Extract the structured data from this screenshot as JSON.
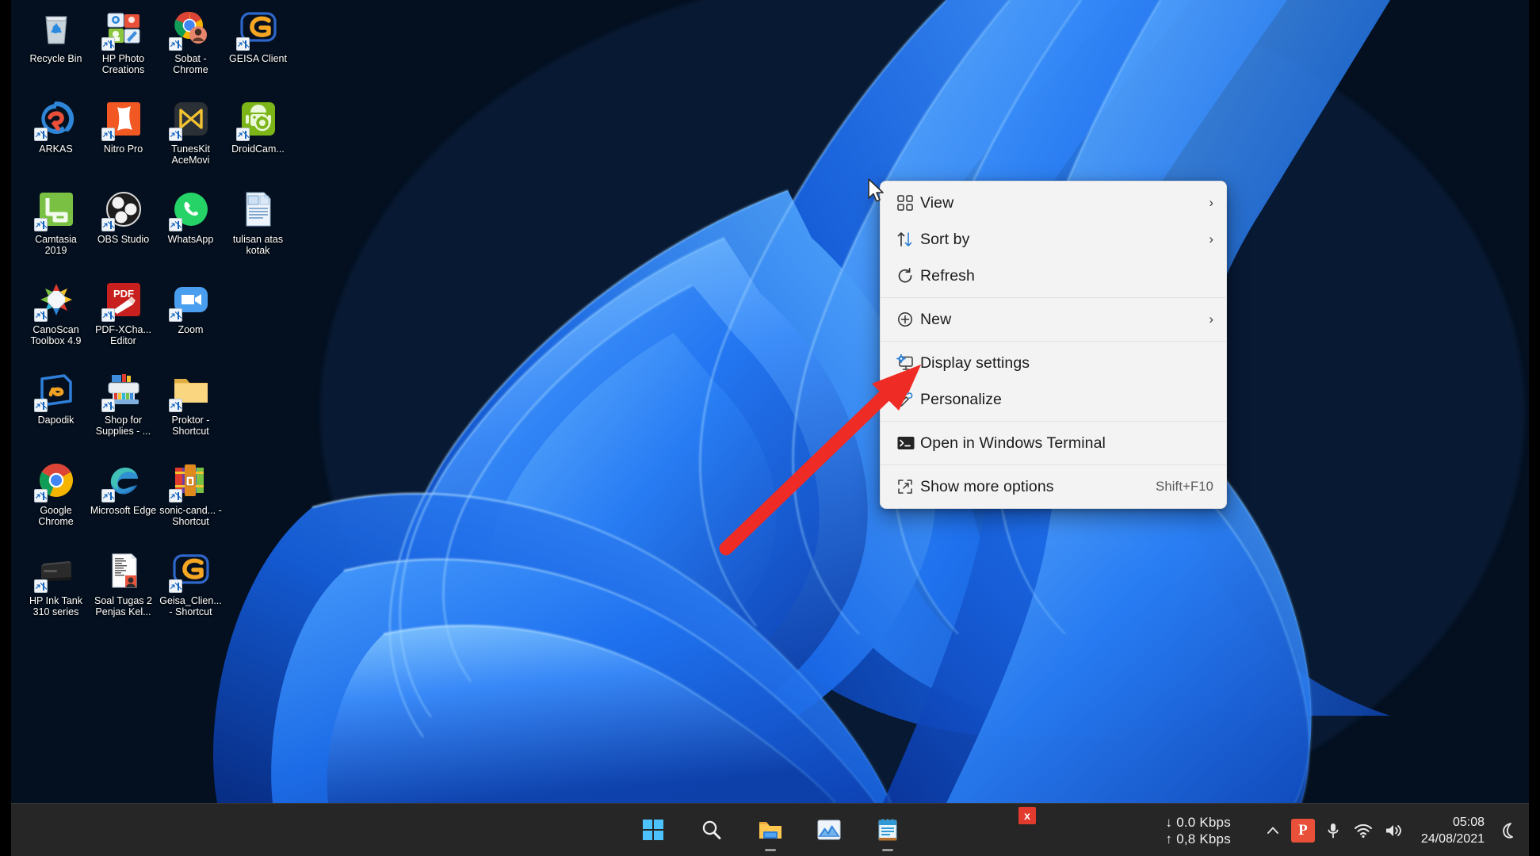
{
  "desktop": {
    "wallpaper_name": "windows-11-bloom-wallpaper",
    "background_color": "#04101f",
    "icons": [
      {
        "label": "Recycle Bin",
        "icon": "recycle-bin-icon",
        "shortcut": false
      },
      {
        "label": "HP Photo Creations",
        "icon": "hp-photo-creations-icon",
        "shortcut": true
      },
      {
        "label": "Sobat - Chrome",
        "icon": "chrome-profile-icon",
        "shortcut": true
      },
      {
        "label": "GEISA Client",
        "icon": "geisa-client-icon",
        "shortcut": true
      },
      {
        "label": "ARKAS",
        "icon": "arkas-icon",
        "shortcut": true
      },
      {
        "label": "Nitro Pro",
        "icon": "nitro-pro-icon",
        "shortcut": true
      },
      {
        "label": "TunesKit AceMovi",
        "icon": "tuneskit-acemovi-icon",
        "shortcut": true
      },
      {
        "label": "DroidCam...",
        "icon": "droidcam-icon",
        "shortcut": true
      },
      {
        "label": "Camtasia 2019",
        "icon": "camtasia-icon",
        "shortcut": true
      },
      {
        "label": "OBS Studio",
        "icon": "obs-studio-icon",
        "shortcut": true
      },
      {
        "label": "WhatsApp",
        "icon": "whatsapp-icon",
        "shortcut": true
      },
      {
        "label": "tulisan atas kotak",
        "icon": "word-document-icon",
        "shortcut": false
      },
      {
        "label": "CanoScan Toolbox 4.9",
        "icon": "canoscan-toolbox-icon",
        "shortcut": true
      },
      {
        "label": "PDF-XCha... Editor",
        "icon": "pdf-xchange-editor-icon",
        "shortcut": true
      },
      {
        "label": "Zoom",
        "icon": "zoom-icon",
        "shortcut": true
      },
      {
        "label": "",
        "icon": "blank-icon",
        "shortcut": false
      },
      {
        "label": "Dapodik",
        "icon": "dapodik-icon",
        "shortcut": true
      },
      {
        "label": "Shop for Supplies - ...",
        "icon": "printer-supplies-icon",
        "shortcut": true
      },
      {
        "label": "Proktor - Shortcut",
        "icon": "folder-icon",
        "shortcut": true
      },
      {
        "label": "",
        "icon": "blank-icon",
        "shortcut": false
      },
      {
        "label": "Google Chrome",
        "icon": "chrome-icon",
        "shortcut": true
      },
      {
        "label": "Microsoft Edge",
        "icon": "edge-icon",
        "shortcut": true
      },
      {
        "label": "sonic-cand... - Shortcut",
        "icon": "winrar-archive-icon",
        "shortcut": true
      },
      {
        "label": "",
        "icon": "blank-icon",
        "shortcut": false
      },
      {
        "label": "HP Ink Tank 310 series",
        "icon": "hp-printer-icon",
        "shortcut": true
      },
      {
        "label": "Soal Tugas 2 Penjas Kel...",
        "icon": "document-icon",
        "shortcut": false
      },
      {
        "label": "Geisa_Clien... - Shortcut",
        "icon": "geisa-client-icon",
        "shortcut": true
      }
    ]
  },
  "context_menu": {
    "name": "desktop-context-menu",
    "items": [
      {
        "label": "View",
        "icon": "view-grid-icon",
        "submenu": true,
        "accel": "",
        "separator_after": false
      },
      {
        "label": "Sort by",
        "icon": "sort-arrows-icon",
        "submenu": true,
        "accel": "",
        "separator_after": false
      },
      {
        "label": "Refresh",
        "icon": "refresh-icon",
        "submenu": false,
        "accel": "",
        "separator_after": true
      },
      {
        "label": "New",
        "icon": "new-plus-icon",
        "submenu": true,
        "accel": "",
        "separator_after": true
      },
      {
        "label": "Display settings",
        "icon": "display-settings-icon",
        "submenu": false,
        "accel": "",
        "separator_after": false
      },
      {
        "label": "Personalize",
        "icon": "personalize-icon",
        "submenu": false,
        "accel": "",
        "separator_after": true
      },
      {
        "label": "Open in Windows Terminal",
        "icon": "terminal-icon",
        "submenu": false,
        "accel": "",
        "separator_after": true
      },
      {
        "label": "Show more options",
        "icon": "show-more-icon",
        "submenu": false,
        "accel": "Shift+F10",
        "separator_after": false
      }
    ],
    "chevron_glyph": "›"
  },
  "annotation": {
    "type": "red-arrow",
    "color": "#ee2b24",
    "points_to": "Display settings"
  },
  "taskbar": {
    "background_color": "#262626",
    "buttons": [
      {
        "label": "Start",
        "icon": "windows-start-icon",
        "running": false
      },
      {
        "label": "Search",
        "icon": "search-icon",
        "running": false
      },
      {
        "label": "File Explorer",
        "icon": "file-explorer-icon",
        "running": true
      },
      {
        "label": "Photos",
        "icon": "photos-icon",
        "running": false
      },
      {
        "label": "Notepad",
        "icon": "notepad-icon",
        "running": true
      }
    ],
    "network_speed": {
      "download": "0.0 Kbps",
      "upload": "0,8 Kbps",
      "download_arrow": "↓",
      "upload_arrow": "↑"
    },
    "tray": [
      {
        "label": "Show hidden icons",
        "icon": "chevron-up-icon"
      },
      {
        "label": "P app",
        "icon": "p-app-icon",
        "badge": "x"
      },
      {
        "label": "Microphone",
        "icon": "microphone-icon"
      },
      {
        "label": "Network",
        "icon": "wifi-icon"
      },
      {
        "label": "Volume",
        "icon": "volume-icon"
      }
    ],
    "badge_text": "x",
    "p_app_letter": "P",
    "clock": {
      "time": "05:08",
      "date": "24/08/2021"
    },
    "notifications_icon": "moon-do-not-disturb-icon"
  }
}
